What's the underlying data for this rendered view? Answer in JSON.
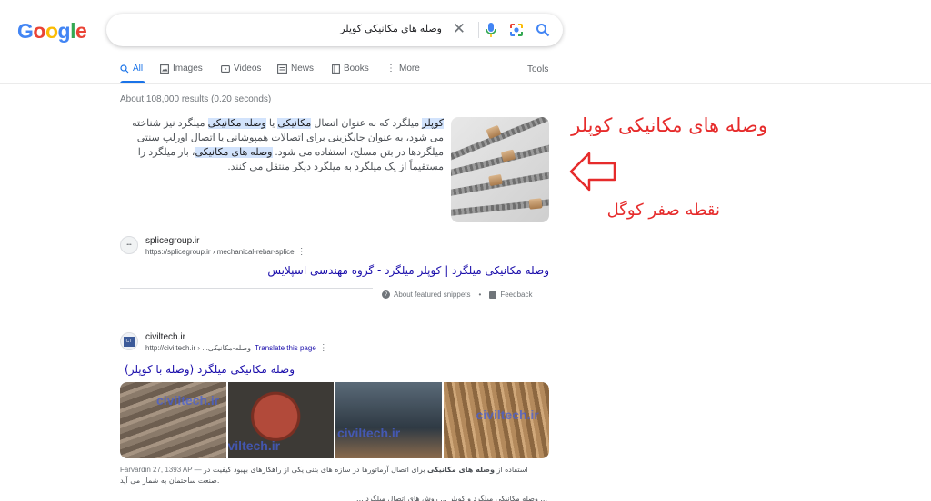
{
  "logo": {
    "letters": [
      "G",
      "o",
      "o",
      "g",
      "l",
      "e"
    ]
  },
  "search": {
    "query": "وصله های مکانیکی کوپلر",
    "clear_icon": "close-icon",
    "mic_icon": "mic-icon",
    "lens_icon": "google-lens-icon",
    "search_icon": "search-icon"
  },
  "tabs": [
    {
      "label": "All",
      "icon": "search-icon",
      "active": true
    },
    {
      "label": "Images",
      "icon": "image-icon"
    },
    {
      "label": "Videos",
      "icon": "video-icon"
    },
    {
      "label": "News",
      "icon": "news-icon"
    },
    {
      "label": "Books",
      "icon": "book-icon"
    },
    {
      "label": "More",
      "icon": "more-vert-icon"
    }
  ],
  "tools_label": "Tools",
  "stats": "About 108,000 results (0.20 seconds)",
  "featured": {
    "parts": [
      {
        "t": "کوپلر",
        "h": true
      },
      {
        "t": " میلگرد که به عنوان اتصال ",
        "h": false
      },
      {
        "t": "مکانیکی",
        "h": true
      },
      {
        "t": " یا ",
        "h": false
      },
      {
        "t": "وصله مکانیکی",
        "h": true
      },
      {
        "t": " میلگرد نیز شناخته می شود، به عنوان جایگزینی برای اتصالات همپوشانی یا اتصال اورلپ سنتی میلگردها در بتن مسلح، استفاده می شود. ",
        "h": false
      },
      {
        "t": "وصله های مکانیکی",
        "h": true
      },
      {
        "t": "، بار میلگرد را مستقیماً از یک میلگرد به میلگرد دیگر منتقل می کنند.",
        "h": false
      }
    ],
    "site_name": "splicegroup.ir",
    "site_url": "https://splicegroup.ir › mechanical-rebar-splice",
    "title": "وصله مکانیکی میلگرد | کوپلر میلگرد - گروه مهندسی اسپلایس",
    "about": "About featured snippets",
    "feedback": "Feedback"
  },
  "annotation": {
    "title": "وصله های مکانیکی کوپلر",
    "subtitle": "نقطه صفر کوگل",
    "color": "#e62b2b"
  },
  "result2": {
    "site_name": "civiltech.ir",
    "site_url": "http://civiltech.ir › ...وصله-مکانیکی",
    "translate": "Translate this page",
    "title": "وصله مکانیکی میلگرد (وصله با کوپلر)",
    "watermarks": [
      "civiltech.ir",
      "viltech.ir",
      "civiltech.ir",
      "civiltech.ir"
    ],
    "date": "Farvardin 27, 1393 AP —",
    "snippet_pre": "استفاده از ",
    "snippet_bold": "وصله های مکانیکی",
    "snippet_post": " برای اتصال آرماتورها در سازه های بتنی یکی از راهکارهای بهبود کیفیت در صنعت ساختمان به شمار می آید.",
    "cut_line": "... وصله مکانیکی میلگرد و کوپلر ... روش های اتصال میلگرد ..."
  },
  "colors": {
    "link": "#1a0dab",
    "accent": "#1a73e8",
    "highlight": "#d2e3fc"
  }
}
